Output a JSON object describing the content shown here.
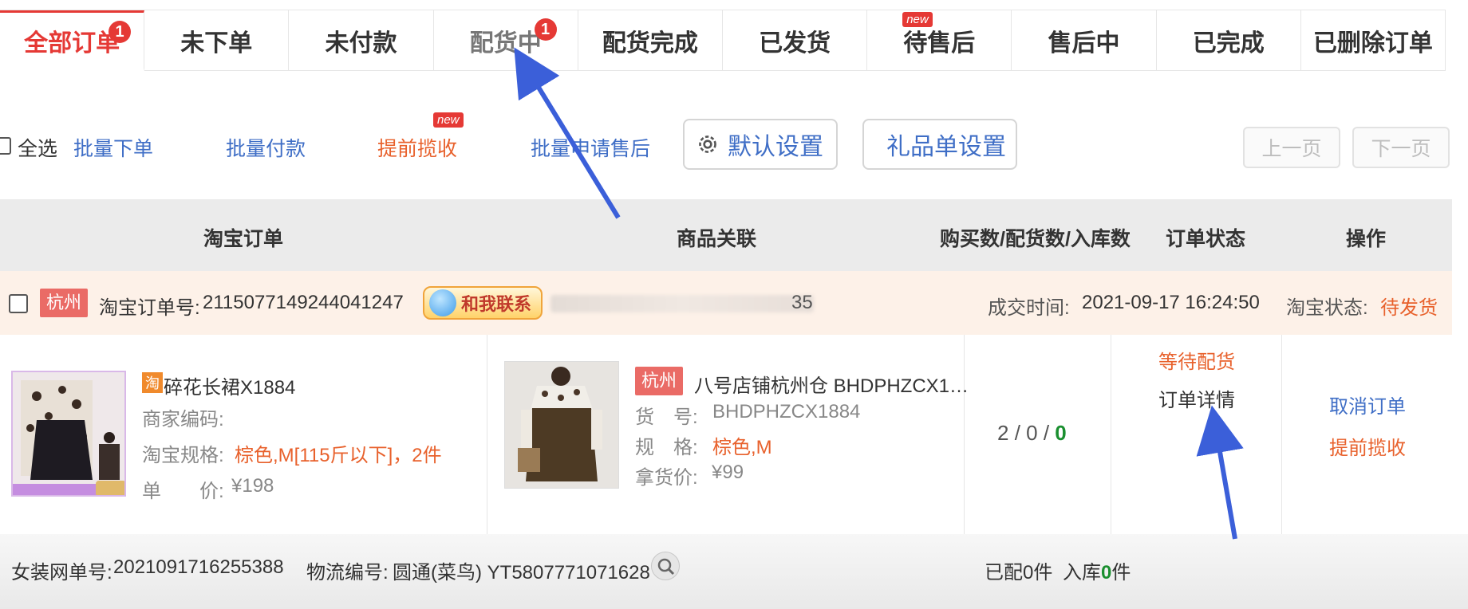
{
  "tabs": [
    {
      "label": "全部订单",
      "badge": "1",
      "active": true
    },
    {
      "label": "未下单"
    },
    {
      "label": "未付款"
    },
    {
      "label": "配货中",
      "badge": "1",
      "dim": true
    },
    {
      "label": "配货完成"
    },
    {
      "label": "已发货"
    },
    {
      "label": "待售后",
      "new_tag": "new"
    },
    {
      "label": "售后中"
    },
    {
      "label": "已完成"
    },
    {
      "label": "已删除订单"
    }
  ],
  "toolbar": {
    "select_all": "全选",
    "batch_order": "批量下单",
    "batch_pay": "批量付款",
    "early_pickup": "提前揽收",
    "early_pickup_tag": "new",
    "batch_aftersale": "批量申请售后",
    "default_settings": "默认设置",
    "gift_settings": "礼品单设置",
    "prev_page": "上一页",
    "next_page": "下一页"
  },
  "table_header": {
    "col_taobao_order": "淘宝订单",
    "col_product_link": "商品关联",
    "col_quantities": "购买数/配货数/入库数",
    "col_status": "订单状态",
    "col_actions": "操作"
  },
  "order": {
    "city": "杭州",
    "order_no_label": "淘宝订单号:",
    "order_no": "2115077149244041247",
    "contact_label": "和我联系",
    "masked_suffix": "35",
    "deal_time_label": "成交时间:",
    "deal_time": "2021-09-17 16:24:50",
    "taobao_status_label": "淘宝状态:",
    "taobao_status": "待发货",
    "taobao_item": {
      "icon": "淘",
      "title": "碎花长裙X1884",
      "merchant_code_label": "商家编码:",
      "spec_label": "淘宝规格:",
      "spec_value": "棕色,M[115斤以下]，2件",
      "price_label": "单　　价:",
      "price": "¥198"
    },
    "linked_product": {
      "city": "杭州",
      "title": "八号店铺杭州仓 BHDPHZCX1…",
      "sku_label": "货　号:",
      "sku": "BHDPHZCX1884",
      "spec_label": "规　格:",
      "spec": "棕色,M",
      "cost_label": "拿货价:",
      "cost": "¥99"
    },
    "quantities": {
      "bought": "2",
      "sep": " / ",
      "allocated": "0",
      "stocked": "0"
    },
    "status": {
      "waiting": "等待配货",
      "details_link": "订单详情"
    },
    "actions": {
      "cancel": "取消订单",
      "early_pickup": "提前揽收"
    },
    "footer": {
      "internal_no_label": "女装网单号:",
      "internal_no": "2021091716255388",
      "logistics_label": "物流编号:",
      "logistics": "圆通(菜鸟) YT5807771071628",
      "allocated_label": "已配",
      "allocated_count": "0",
      "allocated_unit": "件",
      "stocked_label": "入库",
      "stocked_count": "0",
      "stocked_unit": "件"
    }
  },
  "colors": {
    "accent_red": "#e53935",
    "link_blue": "#3f6ec6",
    "orange": "#e8612c",
    "annotation_arrow": "#3b5fd9"
  }
}
